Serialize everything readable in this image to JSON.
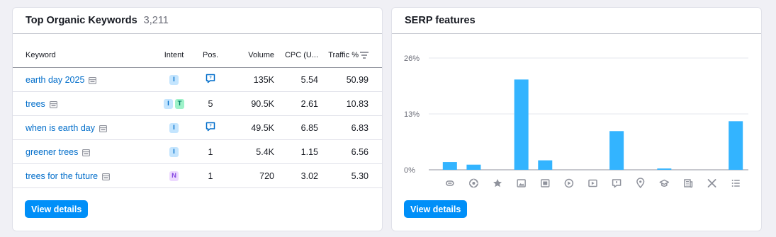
{
  "keywords_card": {
    "title": "Top Organic Keywords",
    "count": "3,211",
    "columns": {
      "keyword": "Keyword",
      "intent": "Intent",
      "pos": "Pos.",
      "volume": "Volume",
      "cpc": "CPC (U...",
      "traffic": "Traffic %"
    },
    "rows": [
      {
        "keyword": "earth day 2025",
        "intent": [
          "I"
        ],
        "pos": "",
        "pos_icon": "reviews-icon",
        "volume": "135K",
        "cpc": "5.54",
        "traffic": "50.99"
      },
      {
        "keyword": "trees",
        "intent": [
          "I",
          "T"
        ],
        "pos": "5",
        "pos_icon": "",
        "volume": "90.5K",
        "cpc": "2.61",
        "traffic": "10.83"
      },
      {
        "keyword": "when is earth day",
        "intent": [
          "I"
        ],
        "pos": "",
        "pos_icon": "reviews-icon",
        "volume": "49.5K",
        "cpc": "6.85",
        "traffic": "6.83"
      },
      {
        "keyword": "greener trees",
        "intent": [
          "I"
        ],
        "pos": "1",
        "pos_icon": "",
        "volume": "5.4K",
        "cpc": "1.15",
        "traffic": "6.56"
      },
      {
        "keyword": "trees for the future",
        "intent": [
          "N"
        ],
        "pos": "1",
        "pos_icon": "",
        "volume": "720",
        "cpc": "3.02",
        "traffic": "5.30"
      }
    ],
    "button_label": "View details"
  },
  "serp_card": {
    "title": "SERP features",
    "button_label": "View details"
  },
  "chart_data": {
    "type": "bar",
    "categories": [
      "link-icon",
      "sitelinks-icon",
      "star-icon",
      "image-icon",
      "image-pack-icon",
      "video-icon",
      "featured-video-icon",
      "reviews-icon",
      "local-pack-icon",
      "graduation-cap-icon",
      "news-icon",
      "x-icon",
      "list-icon"
    ],
    "values": [
      1.8,
      1.2,
      0,
      21.0,
      2.2,
      0,
      0,
      9.0,
      0,
      0.3,
      0,
      0,
      11.3
    ],
    "y_ticks": [
      "0%",
      "13%",
      "26%"
    ],
    "ylim": [
      0,
      26
    ],
    "bar_color": "#33b4ff",
    "grid": true
  },
  "colors": {
    "accent": "#008ff8",
    "link": "#006dca",
    "bar": "#33b4ff"
  }
}
